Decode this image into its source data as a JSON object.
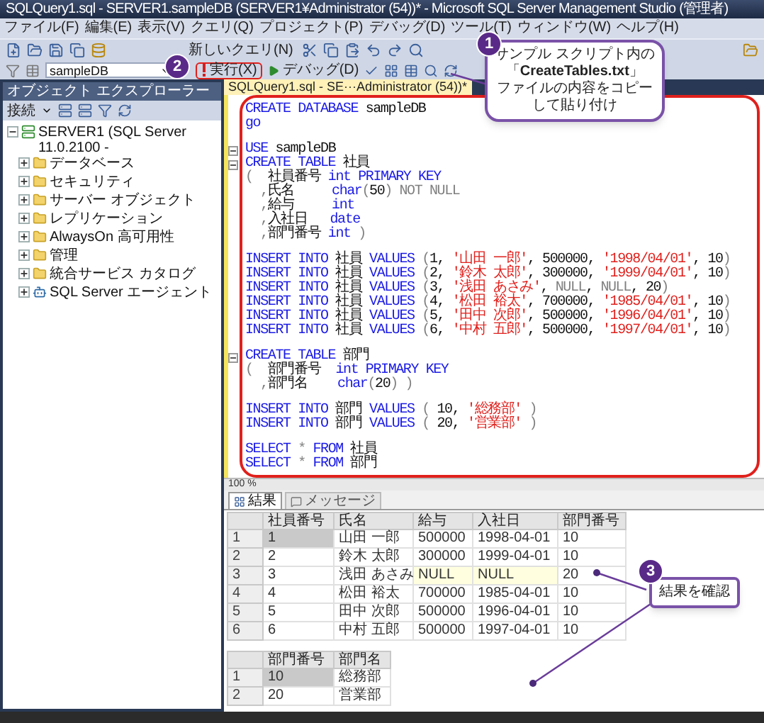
{
  "window": {
    "title": "SQLQuery1.sql - SERVER1.sampleDB (SERVER1¥Administrator (54))* - Microsoft SQL Server Management Studio (管理者)"
  },
  "menu": [
    "ファイル(F)",
    "編集(E)",
    "表示(V)",
    "クエリ(Q)",
    "プロジェクト(P)",
    "デバッグ(D)",
    "ツール(T)",
    "ウィンドウ(W)",
    "ヘルプ(H)"
  ],
  "toolbar": {
    "new_query": "新しいクエリ(N)",
    "database": "sampleDB",
    "execute": "実行(X)",
    "debug": "デバッグ(D)"
  },
  "object_explorer": {
    "title": "オブジェクト エクスプローラー",
    "connect": "接続",
    "tree": [
      {
        "label": "SERVER1 (SQL Server 11.0.2100 -",
        "kind": "server",
        "expanded": true,
        "children": [
          {
            "label": "データベース",
            "kind": "folder",
            "expanded": false
          },
          {
            "label": "セキュリティ",
            "kind": "folder",
            "expanded": false
          },
          {
            "label": "サーバー オブジェクト",
            "kind": "folder",
            "expanded": false
          },
          {
            "label": "レプリケーション",
            "kind": "folder",
            "expanded": false
          },
          {
            "label": "AlwaysOn 高可用性",
            "kind": "folder",
            "expanded": false
          },
          {
            "label": "管理",
            "kind": "folder",
            "expanded": false
          },
          {
            "label": "統合サービス カタログ",
            "kind": "folder",
            "expanded": false
          },
          {
            "label": "SQL Server エージェント",
            "kind": "agent",
            "expanded": false
          }
        ]
      }
    ]
  },
  "editor": {
    "tab": "SQLQuery1.sql - SE···Administrator (54))*",
    "zoom": "100 %",
    "lines": [
      {
        "t": [
          {
            "kind": "kw",
            "s": "CREATE DATABASE"
          },
          {
            "kind": "tx",
            "s": " sampleDB"
          }
        ]
      },
      {
        "t": [
          {
            "kind": "kw",
            "s": "go"
          }
        ]
      },
      {
        "gap": true,
        "fold": true,
        "t": [
          {
            "kind": "kw",
            "s": "USE"
          },
          {
            "kind": "tx",
            "s": " sampleDB"
          }
        ]
      },
      {
        "fold": true,
        "t": [
          {
            "kind": "kw",
            "s": "CREATE TABLE"
          },
          {
            "kind": "tx",
            "s": " 社員"
          }
        ]
      },
      {
        "t": [
          {
            "kind": "op",
            "s": "("
          },
          {
            "kind": "tx",
            "s": "  社員番号 "
          },
          {
            "kind": "kw",
            "s": "int PRIMARY KEY"
          }
        ]
      },
      {
        "t": [
          {
            "kind": "op",
            "s": "  ,"
          },
          {
            "kind": "tx",
            "s": "氏名     "
          },
          {
            "kind": "kw",
            "s": "char"
          },
          {
            "kind": "op",
            "s": "("
          },
          {
            "kind": "tx",
            "s": "50"
          },
          {
            "kind": "op",
            "s": ") NOT NULL"
          }
        ]
      },
      {
        "t": [
          {
            "kind": "op",
            "s": "  ,"
          },
          {
            "kind": "tx",
            "s": "給与     "
          },
          {
            "kind": "kw",
            "s": "int"
          }
        ]
      },
      {
        "t": [
          {
            "kind": "op",
            "s": "  ,"
          },
          {
            "kind": "tx",
            "s": "入社日   "
          },
          {
            "kind": "kw",
            "s": "date"
          }
        ]
      },
      {
        "t": [
          {
            "kind": "op",
            "s": "  ,"
          },
          {
            "kind": "tx",
            "s": "部門番号 "
          },
          {
            "kind": "kw",
            "s": "int"
          },
          {
            "kind": "op",
            "s": " )"
          }
        ]
      },
      {
        "gap": true,
        "t": [
          {
            "kind": "kw",
            "s": "INSERT INTO"
          },
          {
            "kind": "tx",
            "s": " 社員 "
          },
          {
            "kind": "kw",
            "s": "VALUES"
          },
          {
            "kind": "op",
            "s": " ("
          },
          {
            "kind": "tx",
            "s": "1, "
          },
          {
            "kind": "str",
            "s": "'山田 一郎'"
          },
          {
            "kind": "tx",
            "s": ", 500000, "
          },
          {
            "kind": "str",
            "s": "'1998/04/01'"
          },
          {
            "kind": "tx",
            "s": ", 10"
          },
          {
            "kind": "op",
            "s": ")"
          }
        ]
      },
      {
        "t": [
          {
            "kind": "kw",
            "s": "INSERT INTO"
          },
          {
            "kind": "tx",
            "s": " 社員 "
          },
          {
            "kind": "kw",
            "s": "VALUES"
          },
          {
            "kind": "op",
            "s": " ("
          },
          {
            "kind": "tx",
            "s": "2, "
          },
          {
            "kind": "str",
            "s": "'鈴木 太郎'"
          },
          {
            "kind": "tx",
            "s": ", 300000, "
          },
          {
            "kind": "str",
            "s": "'1999/04/01'"
          },
          {
            "kind": "tx",
            "s": ", 10"
          },
          {
            "kind": "op",
            "s": ")"
          }
        ]
      },
      {
        "t": [
          {
            "kind": "kw",
            "s": "INSERT INTO"
          },
          {
            "kind": "tx",
            "s": " 社員 "
          },
          {
            "kind": "kw",
            "s": "VALUES"
          },
          {
            "kind": "op",
            "s": " ("
          },
          {
            "kind": "tx",
            "s": "3, "
          },
          {
            "kind": "str",
            "s": "'浅田 あさみ'"
          },
          {
            "kind": "tx",
            "s": ", "
          },
          {
            "kind": "op",
            "s": "NULL"
          },
          {
            "kind": "tx",
            "s": ", "
          },
          {
            "kind": "op",
            "s": "NULL"
          },
          {
            "kind": "tx",
            "s": ", 20"
          },
          {
            "kind": "op",
            "s": ")"
          }
        ]
      },
      {
        "t": [
          {
            "kind": "kw",
            "s": "INSERT INTO"
          },
          {
            "kind": "tx",
            "s": " 社員 "
          },
          {
            "kind": "kw",
            "s": "VALUES"
          },
          {
            "kind": "op",
            "s": " ("
          },
          {
            "kind": "tx",
            "s": "4, "
          },
          {
            "kind": "str",
            "s": "'松田 裕太'"
          },
          {
            "kind": "tx",
            "s": ", 700000, "
          },
          {
            "kind": "str",
            "s": "'1985/04/01'"
          },
          {
            "kind": "tx",
            "s": ", 10"
          },
          {
            "kind": "op",
            "s": ")"
          }
        ]
      },
      {
        "t": [
          {
            "kind": "kw",
            "s": "INSERT INTO"
          },
          {
            "kind": "tx",
            "s": " 社員 "
          },
          {
            "kind": "kw",
            "s": "VALUES"
          },
          {
            "kind": "op",
            "s": " ("
          },
          {
            "kind": "tx",
            "s": "5, "
          },
          {
            "kind": "str",
            "s": "'田中 次郎'"
          },
          {
            "kind": "tx",
            "s": ", 500000, "
          },
          {
            "kind": "str",
            "s": "'1996/04/01'"
          },
          {
            "kind": "tx",
            "s": ", 10"
          },
          {
            "kind": "op",
            "s": ")"
          }
        ]
      },
      {
        "t": [
          {
            "kind": "kw",
            "s": "INSERT INTO"
          },
          {
            "kind": "tx",
            "s": " 社員 "
          },
          {
            "kind": "kw",
            "s": "VALUES"
          },
          {
            "kind": "op",
            "s": " ("
          },
          {
            "kind": "tx",
            "s": "6, "
          },
          {
            "kind": "str",
            "s": "'中村 五郎'"
          },
          {
            "kind": "tx",
            "s": ", 500000, "
          },
          {
            "kind": "str",
            "s": "'1997/04/01'"
          },
          {
            "kind": "tx",
            "s": ", 10"
          },
          {
            "kind": "op",
            "s": ")"
          }
        ]
      },
      {
        "gap": true,
        "fold": true,
        "t": [
          {
            "kind": "kw",
            "s": "CREATE TABLE"
          },
          {
            "kind": "tx",
            "s": " 部門"
          }
        ]
      },
      {
        "t": [
          {
            "kind": "op",
            "s": "("
          },
          {
            "kind": "tx",
            "s": "  部門番号  "
          },
          {
            "kind": "kw",
            "s": "int PRIMARY KEY"
          }
        ]
      },
      {
        "t": [
          {
            "kind": "op",
            "s": "  ,"
          },
          {
            "kind": "tx",
            "s": "部門名    "
          },
          {
            "kind": "kw",
            "s": "char"
          },
          {
            "kind": "op",
            "s": "("
          },
          {
            "kind": "tx",
            "s": "20"
          },
          {
            "kind": "op",
            "s": ") )"
          }
        ]
      },
      {
        "gap": true,
        "t": [
          {
            "kind": "kw",
            "s": "INSERT INTO"
          },
          {
            "kind": "tx",
            "s": " 部門 "
          },
          {
            "kind": "kw",
            "s": "VALUES"
          },
          {
            "kind": "op",
            "s": " ( "
          },
          {
            "kind": "tx",
            "s": "10, "
          },
          {
            "kind": "str",
            "s": "'総務部'"
          },
          {
            "kind": "op",
            "s": " )"
          }
        ]
      },
      {
        "t": [
          {
            "kind": "kw",
            "s": "INSERT INTO"
          },
          {
            "kind": "tx",
            "s": " 部門 "
          },
          {
            "kind": "kw",
            "s": "VALUES"
          },
          {
            "kind": "op",
            "s": " ( "
          },
          {
            "kind": "tx",
            "s": "20, "
          },
          {
            "kind": "str",
            "s": "'営業部'"
          },
          {
            "kind": "op",
            "s": " )"
          }
        ]
      },
      {
        "gap": true,
        "t": [
          {
            "kind": "kw",
            "s": "SELECT"
          },
          {
            "kind": "op",
            "s": " * "
          },
          {
            "kind": "kw",
            "s": "FROM"
          },
          {
            "kind": "tx",
            "s": " 社員"
          }
        ]
      },
      {
        "t": [
          {
            "kind": "kw",
            "s": "SELECT"
          },
          {
            "kind": "op",
            "s": " * "
          },
          {
            "kind": "kw",
            "s": "FROM"
          },
          {
            "kind": "tx",
            "s": " 部門"
          }
        ]
      }
    ]
  },
  "results": {
    "tabs": [
      {
        "label": "結果",
        "selected": true
      },
      {
        "label": "メッセージ",
        "selected": false
      }
    ],
    "grids": [
      {
        "columns": [
          "社員番号",
          "氏名",
          "給与",
          "入社日",
          "部門番号"
        ],
        "rows": [
          {
            "num": "1",
            "selected": true,
            "cells": [
              "1",
              "山田 一郎",
              "500000",
              "1998-04-01",
              "10"
            ]
          },
          {
            "num": "2",
            "selected": false,
            "cells": [
              "2",
              "鈴木 太郎",
              "300000",
              "1999-04-01",
              "10"
            ]
          },
          {
            "num": "3",
            "selected": false,
            "cells": [
              "3",
              "浅田 あさみ",
              {
                "t": "NULL",
                "kind": "null"
              },
              {
                "t": "NULL",
                "kind": "null"
              },
              "20"
            ]
          },
          {
            "num": "4",
            "selected": false,
            "cells": [
              "4",
              "松田 裕太",
              "700000",
              "1985-04-01",
              "10"
            ]
          },
          {
            "num": "5",
            "selected": false,
            "cells": [
              "5",
              "田中 次郎",
              "500000",
              "1996-04-01",
              "10"
            ]
          },
          {
            "num": "6",
            "selected": false,
            "cells": [
              "6",
              "中村 五郎",
              "500000",
              "1997-04-01",
              "10"
            ]
          }
        ]
      },
      {
        "columns": [
          "部門番号",
          "部門名"
        ],
        "rows": [
          {
            "num": "1",
            "selected": true,
            "cells": [
              "10",
              "総務部"
            ]
          },
          {
            "num": "2",
            "selected": false,
            "cells": [
              "20",
              "営業部"
            ]
          }
        ]
      }
    ]
  },
  "callouts": [
    {
      "number": "1",
      "lines": [
        "サンプル スクリプト内の",
        "「**CreateTables.txt**」",
        "ファイルの内容をコピー",
        "して貼り付け"
      ]
    },
    {
      "number": "2"
    },
    {
      "number": "3",
      "text": "結果を確認"
    }
  ]
}
